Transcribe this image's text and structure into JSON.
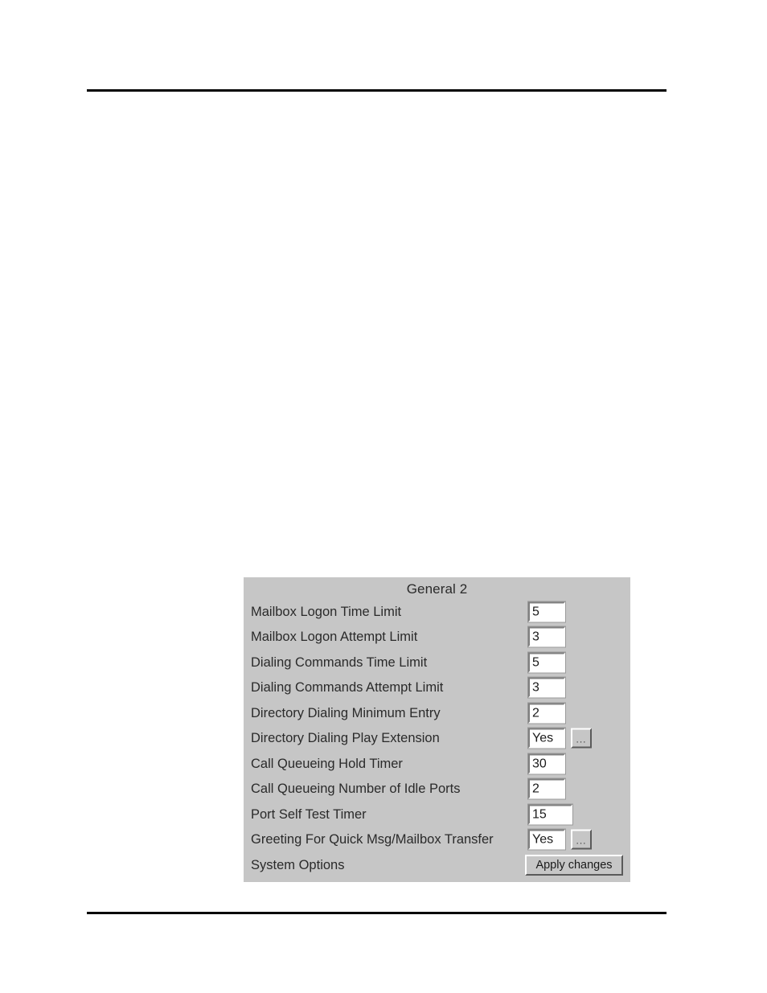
{
  "document": {
    "rules": [
      "header-rule",
      "footer-rule"
    ]
  },
  "panel": {
    "title": "General 2",
    "rows": [
      {
        "label": "Mailbox Logon Time Limit",
        "value": "5",
        "control": "textbox",
        "width": "narrow"
      },
      {
        "label": "Mailbox Logon Attempt Limit",
        "value": "3",
        "control": "textbox",
        "width": "narrow"
      },
      {
        "label": "Dialing Commands Time Limit",
        "value": "5",
        "control": "textbox",
        "width": "narrow"
      },
      {
        "label": "Dialing Commands Attempt Limit",
        "value": "3",
        "control": "textbox",
        "width": "narrow"
      },
      {
        "label": "Directory Dialing Minimum Entry",
        "value": "2",
        "control": "textbox",
        "width": "narrow"
      },
      {
        "label": "Directory Dialing Play Extension",
        "value": "Yes",
        "control": "textbox-with-browse",
        "width": "narrow",
        "browse_label": "..."
      },
      {
        "label": "Call Queueing Hold Timer",
        "value": "30",
        "control": "textbox",
        "width": "narrow"
      },
      {
        "label": "Call Queueing Number of Idle Ports",
        "value": "2",
        "control": "textbox",
        "width": "narrow"
      },
      {
        "label": "Port Self Test Timer",
        "value": "15",
        "control": "textbox",
        "width": "wide"
      },
      {
        "label": "Greeting For Quick Msg/Mailbox Transfer",
        "value": "Yes",
        "control": "textbox-with-browse",
        "width": "narrow",
        "browse_label": "..."
      },
      {
        "label": "System Options",
        "value": "Apply changes",
        "control": "button"
      }
    ]
  },
  "colors": {
    "panel_background": "#c6c6c6",
    "page_background": "#ffffff",
    "field_background": "#ffffff",
    "text": "#2a2a2a",
    "rule": "#000000",
    "border_shadow": "#808080",
    "border_highlight": "#ffffff"
  }
}
